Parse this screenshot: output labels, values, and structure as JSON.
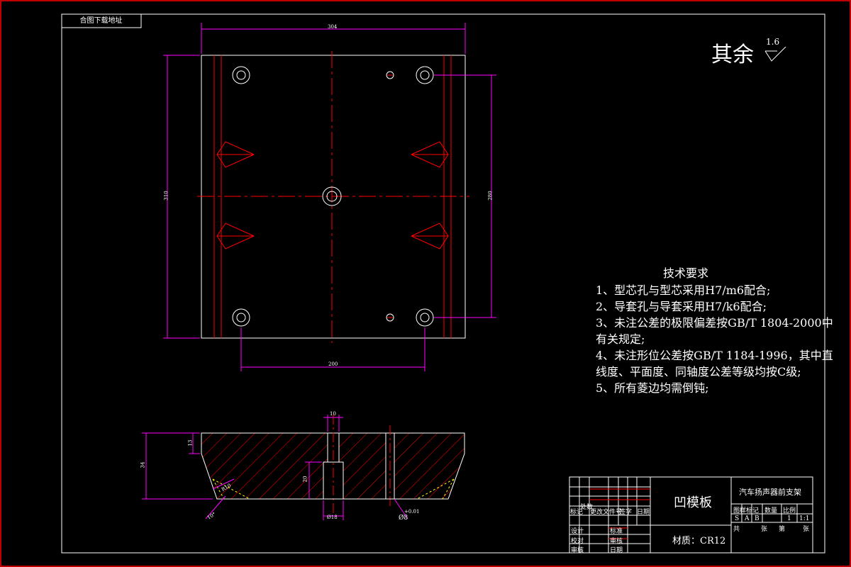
{
  "stamp": "合图下载地址",
  "roughness": {
    "label": "其余",
    "value": "1.6"
  },
  "tech": {
    "title": "技术要求",
    "lines": [
      "1、型芯孔与型芯采用H7/m6配合;",
      "2、导套孔与导套采用H7/k6配合;",
      "3、未注公差的极限偏差按GB/T 1804-2000中",
      "    有关规定;",
      "4、未注形位公差按GB/T 1184-1996，其中直",
      "    线度、平面度、同轴度公差等级均按C级;",
      "5、所有菱边均需倒钝;"
    ]
  },
  "dims": {
    "top_width": "304",
    "left_height": "310",
    "right_height": "280",
    "bottom_width": "200",
    "sec_thick": "34",
    "sec_lip": "13",
    "sec_pin": "10",
    "sec_bore": "20",
    "sec_bore_dia": "Ø18",
    "sec_angle": "R10",
    "sec_chamfer": "10°",
    "sec_hole": "Ø8",
    "sec_hole_tol": "+0.01"
  },
  "title_block": {
    "part_name": "凹模板",
    "material": "材质：CR12",
    "project": "汽车扬声器前支架",
    "rev_headers": [
      "标记",
      "处数",
      "更改文件号",
      "签字",
      "日期"
    ],
    "sign_rows": [
      "设计",
      "校对",
      "审核"
    ],
    "approve_rows": [
      "标准",
      "审核",
      "日期"
    ],
    "info_headers": [
      "图样标记",
      "数量",
      "比例"
    ],
    "info_values": [
      "S",
      "A",
      "B",
      "1",
      "1:1"
    ],
    "sheet_labels": [
      "共",
      "张",
      "第",
      "张"
    ]
  },
  "colors": {
    "background": "#000000",
    "outline": "#ffffff",
    "centerline": "#ff0000",
    "dimension": "#ff00ff",
    "hatch": "#ff0000",
    "border": "#ff0000",
    "leader": "#ffff00"
  }
}
